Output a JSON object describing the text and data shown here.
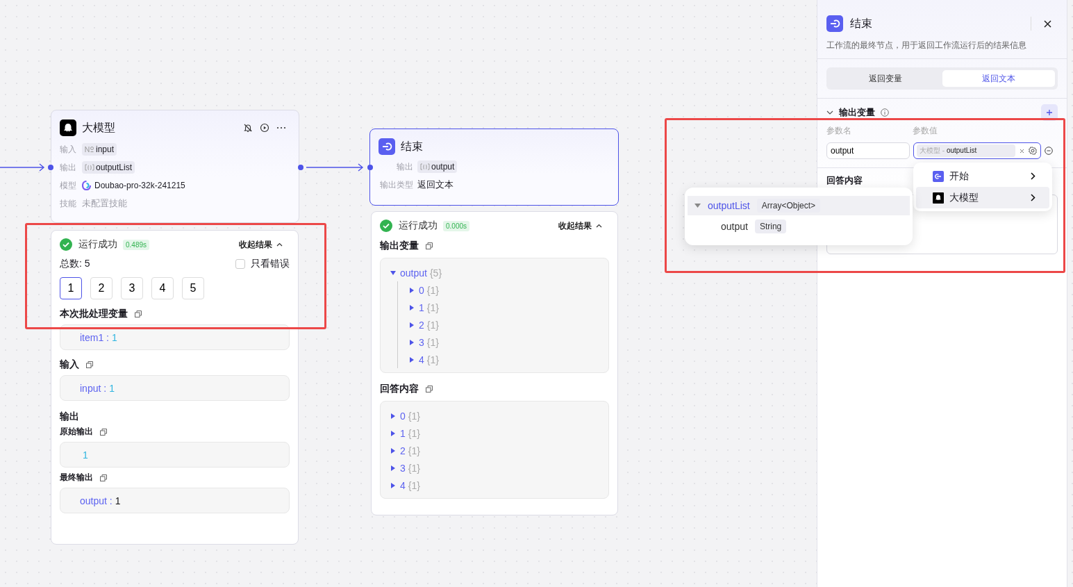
{
  "llm_node": {
    "title": "大模型",
    "rows": [
      {
        "label": "输入",
        "kind": "number_var",
        "value": "input"
      },
      {
        "label": "输出",
        "kind": "array_var",
        "value": "outputList"
      },
      {
        "label": "模型",
        "kind": "model",
        "value": "Doubao-pro-32k-241215"
      },
      {
        "label": "技能",
        "kind": "empty",
        "value": "未配置技能"
      }
    ]
  },
  "llm_result": {
    "status": "运行成功",
    "time": "0.489s",
    "collapse": "收起结果",
    "total": "总数: 5",
    "errors_only": {
      "label": "只看错误",
      "checked": false
    },
    "pages": [
      {
        "label": "1",
        "selected": true
      },
      {
        "label": "2",
        "selected": false
      },
      {
        "label": "3",
        "selected": false
      },
      {
        "label": "4",
        "selected": false
      },
      {
        "label": "5",
        "selected": false
      }
    ],
    "sections": [
      {
        "kind": "box",
        "title": "本次批处理变量",
        "key": "item1 :",
        "value": {
          "kind": "number",
          "text": "1"
        }
      },
      {
        "kind": "box",
        "title": "输入",
        "key": "input :",
        "value": {
          "kind": "number",
          "text": "1"
        }
      },
      {
        "kind": "heading",
        "title": "输出"
      },
      {
        "kind": "subbox",
        "title": "原始输出",
        "value": {
          "kind": "number",
          "text": "1"
        }
      },
      {
        "kind": "subbox",
        "title": "最终输出",
        "key": "output :",
        "value": {
          "kind": "string",
          "text": "1"
        }
      }
    ]
  },
  "end_node": {
    "title": "结束",
    "rows": [
      {
        "label": "输出",
        "kind": "array_var",
        "value": "output"
      },
      {
        "label": "输出类型",
        "kind": "text",
        "value": "返回文本"
      }
    ]
  },
  "end_result": {
    "status": "运行成功",
    "time": "0.000s",
    "collapse": "收起结果",
    "output_vars": {
      "title": "输出变量",
      "tree": {
        "key": "output",
        "count": "{5}",
        "expanded": true,
        "children": [
          {
            "key": "0",
            "count": "{1}",
            "expanded": false
          },
          {
            "key": "1",
            "count": "{1}",
            "expanded": false
          },
          {
            "key": "2",
            "count": "{1}",
            "expanded": false
          },
          {
            "key": "3",
            "count": "{1}",
            "expanded": false
          },
          {
            "key": "4",
            "count": "{1}",
            "expanded": false
          }
        ]
      }
    },
    "answer": {
      "title": "回答内容",
      "items": [
        {
          "key": "0",
          "count": "{1}",
          "expanded": false
        },
        {
          "key": "1",
          "count": "{1}",
          "expanded": false
        },
        {
          "key": "2",
          "count": "{1}",
          "expanded": false
        },
        {
          "key": "3",
          "count": "{1}",
          "expanded": false
        },
        {
          "key": "4",
          "count": "{1}",
          "expanded": false
        }
      ]
    }
  },
  "panel": {
    "title": "结束",
    "description": "工作流的最终节点，用于返回工作流运行后的结果信息",
    "tabs": [
      {
        "label": "返回变量",
        "selected": false
      },
      {
        "label": "返回文本",
        "selected": true
      }
    ],
    "output_section": {
      "title": "输出变量",
      "expanded": true,
      "col_name": "参数名",
      "col_value": "参数值",
      "rows": [
        {
          "name": "output",
          "source": "大模型 -",
          "variable": "outputList"
        }
      ]
    },
    "answer_section": {
      "title": "回答内容"
    }
  },
  "source_menu": [
    {
      "label": "开始",
      "kind": "start",
      "selected": false
    },
    {
      "label": "大模型",
      "kind": "llm",
      "selected": true
    }
  ],
  "variable_menu": [
    {
      "name": "outputList",
      "type": "Array<Object>",
      "expanded": true,
      "selected": true,
      "children": [
        {
          "name": "output",
          "type": "String"
        }
      ]
    }
  ]
}
